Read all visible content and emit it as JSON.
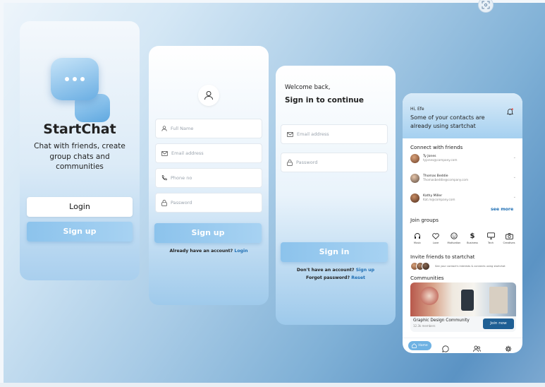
{
  "screen1": {
    "brand": "StartChat",
    "tagline": "Chat with friends, create group chats and communities",
    "login_label": "Login",
    "signup_label": "Sign up"
  },
  "screen2": {
    "fields": {
      "full_name": "Full Name",
      "email": "Email address",
      "phone": "Phone no",
      "password": "Password"
    },
    "signup_label": "Sign up",
    "have_account_text": "Already have an account?",
    "login_link": "Login"
  },
  "screen3": {
    "welcome": "Welcome back,",
    "subtitle": "Sign in to continue",
    "fields": {
      "email": "Email address",
      "password": "Password"
    },
    "signin_label": "Sign in",
    "no_account_text": "Don't have an account?",
    "signup_link": "Sign up",
    "forgot_text": "Forgot password?",
    "reset_link": "Reset"
  },
  "screen4": {
    "greeting": "Hi, Efe",
    "headline": "Some of your contacts are already using startchat",
    "connect_title": "Connect with friends",
    "contacts": [
      {
        "name": "Ty Jones",
        "email": "tyjones@company.com"
      },
      {
        "name": "Thomas Beddie",
        "email": "Thomasbeddie@company.com"
      },
      {
        "name": "Kathy Miller",
        "email": "Kat.m@company.com"
      }
    ],
    "see_more": "see more",
    "groups_title": "Join groups",
    "groups": [
      {
        "icon": "headphones-icon",
        "label": "Music"
      },
      {
        "icon": "heart-icon",
        "label": "Love"
      },
      {
        "icon": "smile-icon",
        "label": "Motivation"
      },
      {
        "icon": "dollar-icon",
        "label": "Business"
      },
      {
        "icon": "monitor-icon",
        "label": "Tech"
      },
      {
        "icon": "camera-icon",
        "label": "Creatives"
      }
    ],
    "invite_title": "Invite friends to startchat",
    "invite_text": "See your contact's interests & connects using startchat",
    "communities_title": "Communities",
    "community": {
      "name": "Graphic Design Community",
      "members": "12.3k members",
      "join_label": "Join now"
    },
    "nav": {
      "home_label": "Home"
    }
  },
  "colors": {
    "accent": "#6fb2e3",
    "link": "#1f6fb4",
    "dark_button": "#1f5f94"
  }
}
